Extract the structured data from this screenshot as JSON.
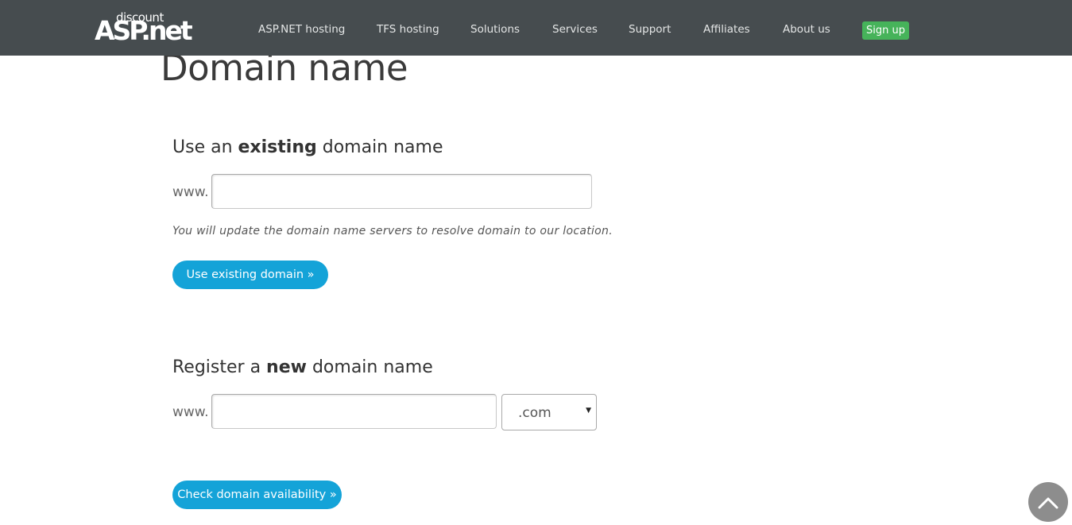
{
  "logo": {
    "small_text": "discount",
    "big_text": "ASP.net"
  },
  "nav": {
    "items": [
      {
        "label": "ASP.NET hosting"
      },
      {
        "label": "TFS hosting"
      },
      {
        "label": "Solutions"
      },
      {
        "label": "Services"
      },
      {
        "label": "Support"
      },
      {
        "label": "Affiliates"
      },
      {
        "label": "About us"
      }
    ],
    "signup_label": "Sign up"
  },
  "page": {
    "title": "Domain name"
  },
  "existing": {
    "title_pre": "Use an ",
    "title_bold": "existing",
    "title_post": " domain name",
    "prefix": "www.",
    "input_value": "",
    "hint": "You will update the domain name servers to resolve domain to our location.",
    "button_label": "Use existing domain »"
  },
  "register": {
    "title_pre": "Register a ",
    "title_bold": "new",
    "title_post": " domain name",
    "prefix": "www.",
    "input_value": "",
    "tld_selected": ".com",
    "button_label": "Check domain availability »"
  },
  "icons": {
    "scroll_top": "chevron-up-icon",
    "select_arrow": "caret-down-icon"
  },
  "colors": {
    "topbar": "#464c4f",
    "accent_button": "#14a3d8",
    "signup": "#46b35a"
  }
}
